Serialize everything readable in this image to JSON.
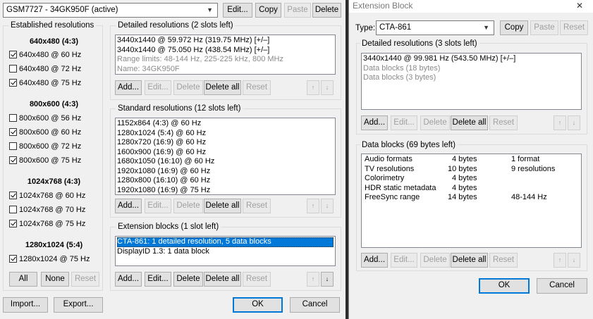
{
  "main": {
    "display_select": "GSM7727 - 34GK950F (active)",
    "top_buttons": {
      "edit": "Edit...",
      "copy": "Copy",
      "paste": "Paste",
      "delete": "Delete"
    },
    "established": {
      "title": "Established resolutions",
      "groups": [
        {
          "heading": "640x480 (4:3)",
          "items": [
            {
              "label": "640x480 @ 60 Hz",
              "checked": true
            },
            {
              "label": "640x480 @ 72 Hz",
              "checked": false
            },
            {
              "label": "640x480 @ 75 Hz",
              "checked": true
            }
          ]
        },
        {
          "heading": "800x600 (4:3)",
          "items": [
            {
              "label": "800x600 @ 56 Hz",
              "checked": false
            },
            {
              "label": "800x600 @ 60 Hz",
              "checked": true
            },
            {
              "label": "800x600 @ 72 Hz",
              "checked": false
            },
            {
              "label": "800x600 @ 75 Hz",
              "checked": true
            }
          ]
        },
        {
          "heading": "1024x768 (4:3)",
          "items": [
            {
              "label": "1024x768 @ 60 Hz",
              "checked": true
            },
            {
              "label": "1024x768 @ 70 Hz",
              "checked": false
            },
            {
              "label": "1024x768 @ 75 Hz",
              "checked": true
            }
          ]
        },
        {
          "heading": "1280x1024 (5:4)",
          "items": [
            {
              "label": "1280x1024 @ 75 Hz",
              "checked": true
            }
          ]
        }
      ],
      "buttons": {
        "all": "All",
        "none": "None",
        "reset": "Reset"
      }
    },
    "detailed": {
      "title": "Detailed resolutions (2 slots left)",
      "rows": [
        {
          "text": "3440x1440 @ 59.972 Hz (319.75 MHz) [+/–]",
          "grey": false
        },
        {
          "text": "3440x1440 @ 75.050 Hz (438.54 MHz) [+/–]",
          "grey": false
        },
        {
          "text": "Range limits: 48-144 Hz, 225-225 kHz, 800 MHz",
          "grey": true
        },
        {
          "text": "Name: 34GK950F",
          "grey": true
        }
      ]
    },
    "standard": {
      "title": "Standard resolutions (12 slots left)",
      "rows": [
        "1152x864 (4:3) @ 60 Hz",
        "1280x1024 (5:4) @ 60 Hz",
        "1280x720 (16:9) @ 60 Hz",
        "1600x900 (16:9) @ 60 Hz",
        "1680x1050 (16:10) @ 60 Hz",
        "1920x1080 (16:9) @ 60 Hz",
        "1280x800 (16:10) @ 60 Hz",
        "1920x1080 (16:9) @ 75 Hz"
      ]
    },
    "extension": {
      "title": "Extension blocks (1 slot left)",
      "rows": [
        {
          "text": "CTA-861: 1 detailed resolution, 5 data blocks",
          "selected": true
        },
        {
          "text": "DisplayID 1.3: 1 data block",
          "selected": false
        }
      ]
    },
    "list_buttons": {
      "add": "Add...",
      "edit": "Edit...",
      "delete": "Delete",
      "delete_all": "Delete all",
      "reset": "Reset",
      "up": "↑",
      "down": "↓"
    },
    "footer": {
      "import": "Import...",
      "export": "Export...",
      "ok": "OK",
      "cancel": "Cancel"
    }
  },
  "ext_dialog": {
    "title": "Extension Block",
    "close": "✕",
    "type_label": "Type:",
    "type_value": "CTA-861",
    "buttons": {
      "copy": "Copy",
      "paste": "Paste",
      "reset": "Reset"
    },
    "detailed": {
      "title": "Detailed resolutions (3 slots left)",
      "rows": [
        {
          "text": "3440x1440 @ 99.981 Hz (543.50 MHz) [+/–]",
          "grey": false
        },
        {
          "text": "Data blocks (18 bytes)",
          "grey": true
        },
        {
          "text": "Data blocks (3 bytes)",
          "grey": true
        }
      ]
    },
    "datablocks": {
      "title": "Data blocks (69 bytes left)",
      "rows": [
        {
          "name": "Audio formats",
          "size": "4 bytes",
          "info": "1 format"
        },
        {
          "name": "TV resolutions",
          "size": "10 bytes",
          "info": "9 resolutions"
        },
        {
          "name": "Colorimetry",
          "size": "4 bytes",
          "info": ""
        },
        {
          "name": "HDR static metadata",
          "size": "4 bytes",
          "info": ""
        },
        {
          "name": "FreeSync range",
          "size": "14 bytes",
          "info": "48-144 Hz"
        }
      ]
    },
    "list_buttons": {
      "add": "Add...",
      "edit": "Edit...",
      "delete": "Delete",
      "delete_all": "Delete all",
      "reset": "Reset",
      "up": "↑",
      "down": "↓"
    },
    "footer": {
      "ok": "OK",
      "cancel": "Cancel"
    }
  }
}
